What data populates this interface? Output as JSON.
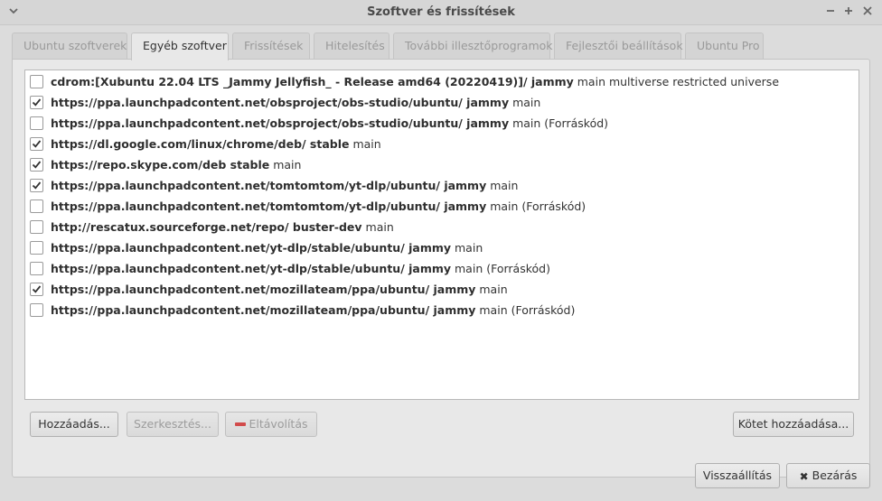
{
  "window": {
    "title": "Szoftver és frissítések"
  },
  "tabs": [
    {
      "label": "Ubuntu szoftverek",
      "active": false
    },
    {
      "label": "Egyéb szoftver",
      "active": true
    },
    {
      "label": "Frissítések",
      "active": false
    },
    {
      "label": "Hitelesítés",
      "active": false
    },
    {
      "label": "További illesztőprogramok",
      "active": false
    },
    {
      "label": "Fejlesztői beállítások",
      "active": false
    },
    {
      "label": "Ubuntu Pro",
      "active": false
    }
  ],
  "sources": [
    {
      "checked": false,
      "bold": "cdrom:[Xubuntu 22.04 LTS _Jammy Jellyfish_ - Release amd64 (20220419)]/ jammy",
      "rest": " main multiverse restricted universe"
    },
    {
      "checked": true,
      "bold": "https://ppa.launchpadcontent.net/obsproject/obs-studio/ubuntu/ jammy",
      "rest": " main"
    },
    {
      "checked": false,
      "bold": "https://ppa.launchpadcontent.net/obsproject/obs-studio/ubuntu/ jammy",
      "rest": " main (Forráskód)"
    },
    {
      "checked": true,
      "bold": "https://dl.google.com/linux/chrome/deb/ stable",
      "rest": " main"
    },
    {
      "checked": true,
      "bold": "https://repo.skype.com/deb stable",
      "rest": " main"
    },
    {
      "checked": true,
      "bold": "https://ppa.launchpadcontent.net/tomtomtom/yt-dlp/ubuntu/ jammy",
      "rest": " main"
    },
    {
      "checked": false,
      "bold": "https://ppa.launchpadcontent.net/tomtomtom/yt-dlp/ubuntu/ jammy",
      "rest": " main (Forráskód)"
    },
    {
      "checked": false,
      "bold": "http://rescatux.sourceforge.net/repo/ buster-dev",
      "rest": " main"
    },
    {
      "checked": false,
      "bold": "https://ppa.launchpadcontent.net/yt-dlp/stable/ubuntu/ jammy",
      "rest": " main"
    },
    {
      "checked": false,
      "bold": "https://ppa.launchpadcontent.net/yt-dlp/stable/ubuntu/ jammy",
      "rest": " main (Forráskód)"
    },
    {
      "checked": true,
      "bold": "https://ppa.launchpadcontent.net/mozillateam/ppa/ubuntu/ jammy",
      "rest": " main"
    },
    {
      "checked": false,
      "bold": "https://ppa.launchpadcontent.net/mozillateam/ppa/ubuntu/ jammy",
      "rest": " main (Forráskód)"
    }
  ],
  "buttons": {
    "add": "Hozzáadás...",
    "edit": "Szerkesztés...",
    "remove": "Eltávolítás",
    "add_volume": "Kötet hozzáadása...",
    "revert": "Visszaállítás",
    "close": "Bezárás"
  },
  "icons": {
    "menu": "chevron-down-icon",
    "minimize": "minimize-icon",
    "maximize": "maximize-icon",
    "close": "close-icon",
    "remove": "minus-icon",
    "close_button": "x-icon"
  },
  "colors": {
    "remove_icon": "#d24b4b"
  }
}
